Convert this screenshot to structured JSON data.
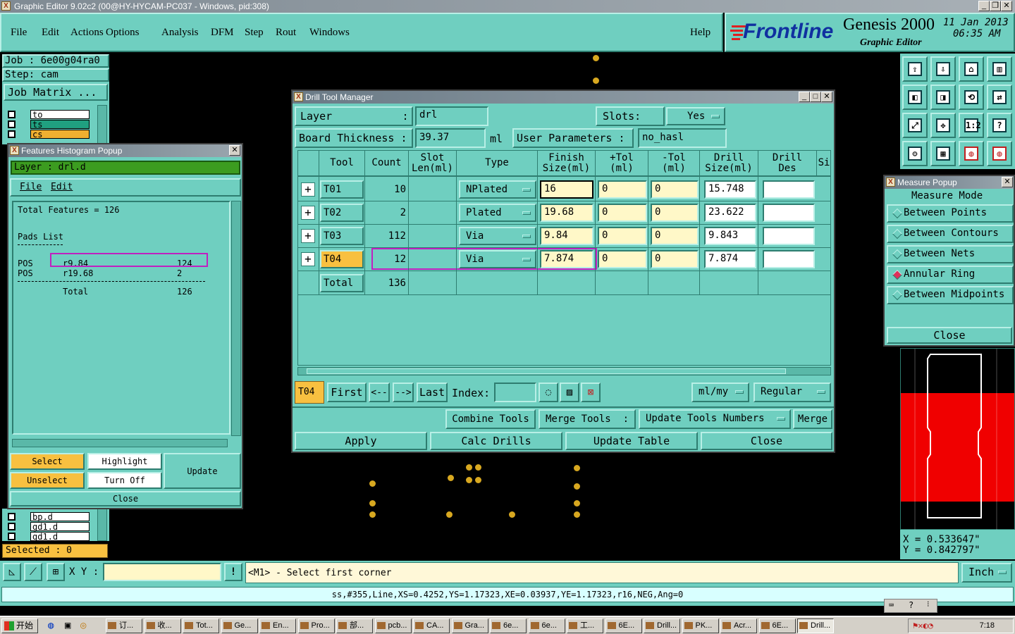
{
  "window": {
    "title": "Graphic Editor 9.02c2 (00@HY-HYCAM-PC037 - Windows, pid:308)"
  },
  "menu": {
    "items": [
      "File",
      "Edit",
      "Actions",
      "Options",
      "Analysis",
      "DFM",
      "Step",
      "Rout",
      "Windows"
    ],
    "help": "Help"
  },
  "brand": {
    "logo": "Frontline",
    "product": "Genesis 2000",
    "subtitle": "Graphic Editor",
    "date": "11 Jan 2013",
    "time": "06:35 AM"
  },
  "job": {
    "job": "Job : 6e00g04ra0",
    "step": "Step: cam",
    "matrix_button": "Job Matrix ..."
  },
  "layers_top": [
    {
      "name": "to",
      "color": "#ffffff"
    },
    {
      "name": "ts",
      "color": "#20a080"
    },
    {
      "name": "cs",
      "color": "#f0b030"
    }
  ],
  "layers_bottom": [
    {
      "name": "bp.d",
      "color": "#ffffff"
    },
    {
      "name": "gd1.d",
      "color": "#ffffff"
    },
    {
      "name": "gd1.d",
      "color": "#ffffff"
    }
  ],
  "selected": "Selected : 0",
  "histogram": {
    "title": "Features Histogram Popup",
    "layer": "Layer :  drl.d",
    "menu": [
      "File",
      "Edit"
    ],
    "total_features": "Total Features = 126",
    "pads_list": "Pads List",
    "rows": [
      {
        "type": "POS",
        "sym": "r9.84",
        "count": "124"
      },
      {
        "type": "POS",
        "sym": "r19.68",
        "count": "2"
      }
    ],
    "total_label": "Total",
    "total_value": "126",
    "buttons": {
      "select": "Select",
      "highlight": "Highlight",
      "unselect": "Unselect",
      "turn_off": "Turn Off",
      "update": "Update",
      "close": "Close"
    }
  },
  "dtm": {
    "title": "Drill Tool Manager",
    "layer_label": "Layer           :",
    "layer_value": "drl",
    "slots_label": "Slots:",
    "slots_value": "Yes",
    "thickness_label": "Board Thickness :",
    "thickness_value": "39.37",
    "thickness_unit": "ml",
    "user_params_label": "User Parameters :",
    "user_params_value": "no_hasl",
    "columns": [
      {
        "l1": "Tool",
        "l2": ""
      },
      {
        "l1": "Count",
        "l2": ""
      },
      {
        "l1": "Slot",
        "l2": "Len(ml)"
      },
      {
        "l1": "Type",
        "l2": ""
      },
      {
        "l1": "Finish",
        "l2": "Size(ml)"
      },
      {
        "l1": "+Tol",
        "l2": "(ml)"
      },
      {
        "l1": "-Tol",
        "l2": "(ml)"
      },
      {
        "l1": "Drill",
        "l2": "Size(ml)"
      },
      {
        "l1": "Drill",
        "l2": "Des"
      },
      {
        "l1": "Si",
        "l2": ""
      }
    ],
    "rows": [
      {
        "tool": "T01",
        "count": "10",
        "type": "NPlated",
        "finish": "16",
        "ptol": "0",
        "mtol": "0",
        "drill": "15.748"
      },
      {
        "tool": "T02",
        "count": "2",
        "type": "Plated",
        "finish": "19.68",
        "ptol": "0",
        "mtol": "0",
        "drill": "23.622"
      },
      {
        "tool": "T03",
        "count": "112",
        "type": "Via",
        "finish": "9.84",
        "ptol": "0",
        "mtol": "0",
        "drill": "9.843"
      },
      {
        "tool": "T04",
        "count": "12",
        "type": "Via",
        "finish": "7.874",
        "ptol": "0",
        "mtol": "0",
        "drill": "7.874"
      }
    ],
    "total_label": "Total",
    "total_count": "136",
    "nav": {
      "current": "T04",
      "first": "First",
      "prev": "<--",
      "next": "-->",
      "last": "Last",
      "index_label": "Index:",
      "units": "ml/my",
      "mode": "Regular"
    },
    "actions": {
      "combine": "Combine Tools",
      "merge_label": "Merge Tools  :",
      "update_numbers": "Update Tools Numbers",
      "merge": "Merge"
    },
    "bottom": {
      "apply": "Apply",
      "calc": "Calc Drills",
      "update_table": "Update Table",
      "close": "Close"
    }
  },
  "measure": {
    "title": "Measure Popup",
    "mode_label": "Measure Mode",
    "options": [
      "Between Points",
      "Between Contours",
      "Between Nets",
      "Annular Ring",
      "Between Midpoints"
    ],
    "selected_index": 3,
    "close": "Close"
  },
  "coords": {
    "x": "X = 0.533647\"",
    "y": "Y = 0.842797\""
  },
  "prompt": {
    "xy_label": "X Y :",
    "message": "<M1> - Select first corner",
    "units": "Inch"
  },
  "status_line": "ss,#355,Line,XS=0.4252,YS=1.17323,XE=0.03937,YE=1.17323,r16,NEG,Ang=0",
  "taskbar": {
    "start": "开始",
    "tasks": [
      "订...",
      "收...",
      "Tot...",
      "Ge...",
      "En...",
      "Pro...",
      "部...",
      "pcb...",
      "CA...",
      "Gra...",
      "6e...",
      "6e...",
      "工...",
      "6E...",
      "Drill...",
      "PK...",
      "Acr...",
      "6E...",
      "Drill..."
    ],
    "clock": "7:18"
  },
  "colors": {
    "teal": "#6fcfc0",
    "highlight": "#f8c040",
    "layer_green": "#3c9c20",
    "accent_magenta": "#c020c0"
  }
}
